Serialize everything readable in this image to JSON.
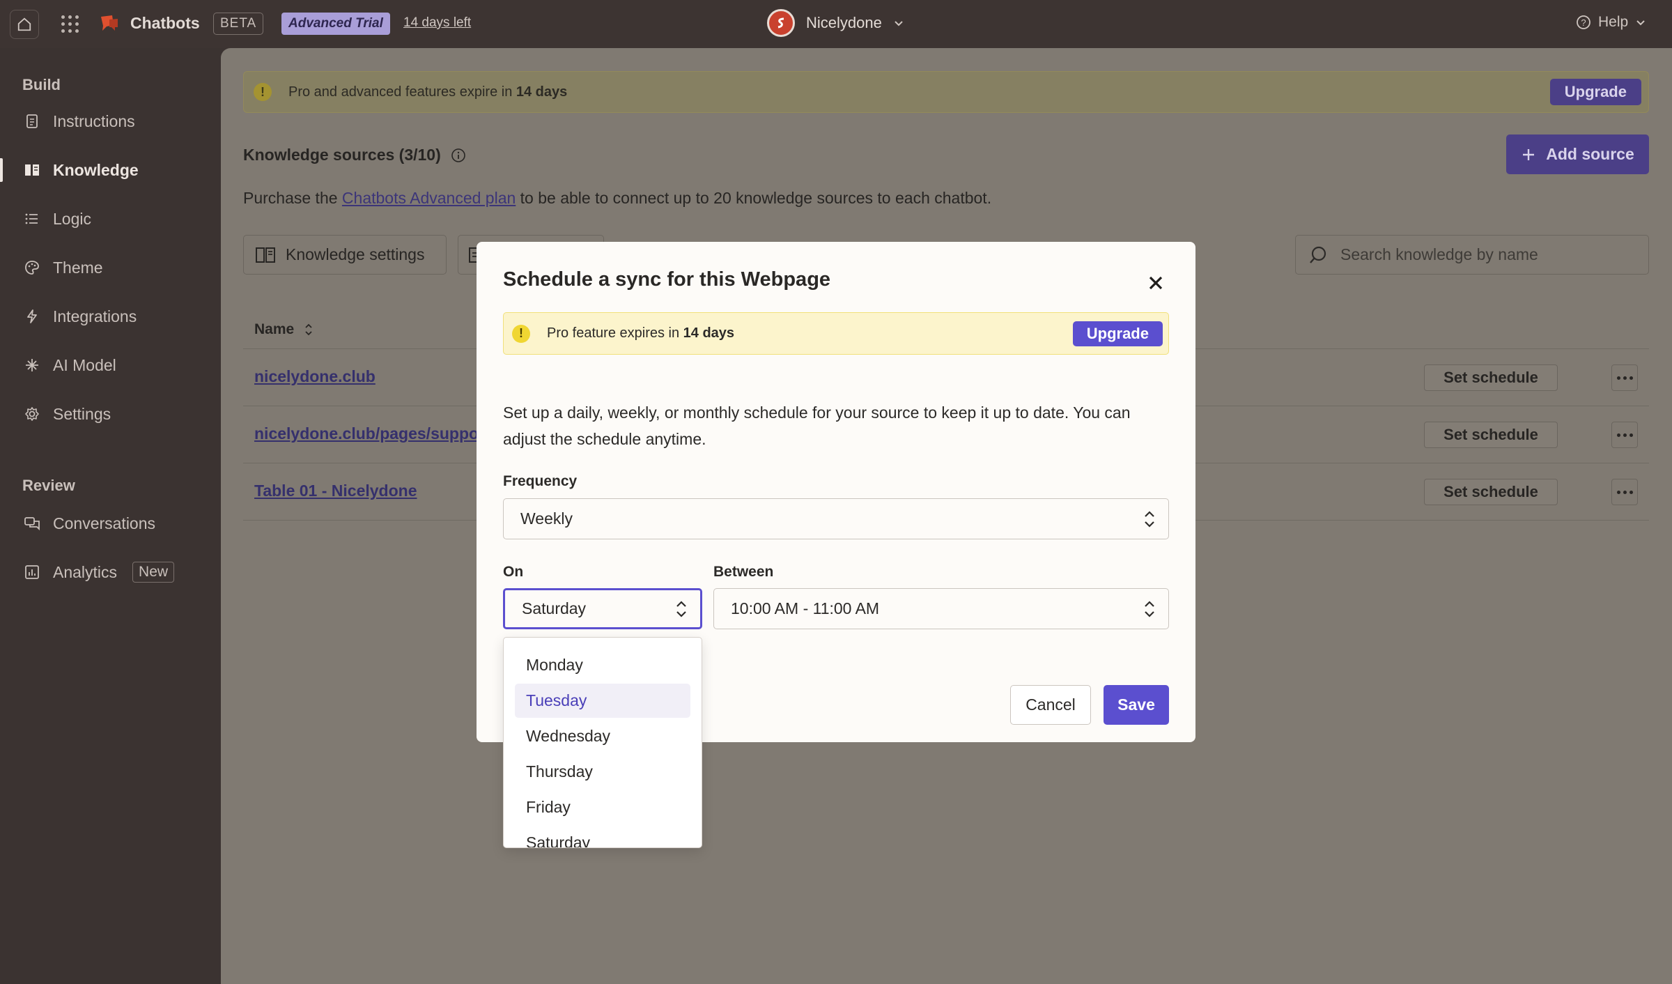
{
  "topbar": {
    "app_name": "Chatbots",
    "beta_label": "BETA",
    "trial_label": "Advanced Trial",
    "days_left": "14 days left",
    "workspace_name": "Nicelydone",
    "help_label": "Help"
  },
  "sidebar": {
    "build_heading": "Build",
    "review_heading": "Review",
    "items": [
      {
        "label": "Instructions",
        "icon": "document-icon"
      },
      {
        "label": "Knowledge",
        "icon": "book-icon",
        "active": true
      },
      {
        "label": "Logic",
        "icon": "list-icon"
      },
      {
        "label": "Theme",
        "icon": "palette-icon"
      },
      {
        "label": "Integrations",
        "icon": "bolt-icon"
      },
      {
        "label": "AI Model",
        "icon": "sparkle-icon"
      },
      {
        "label": "Settings",
        "icon": "gear-icon"
      }
    ],
    "review_items": [
      {
        "label": "Conversations",
        "icon": "chat-icon"
      },
      {
        "label": "Analytics",
        "icon": "chart-icon",
        "badge": "New"
      }
    ]
  },
  "main": {
    "banner_prefix": "Pro and advanced features expire in ",
    "banner_bold": "14 days",
    "upgrade_label": "Upgrade",
    "ks_title": "Knowledge sources (3/10)",
    "add_source_label": "Add source",
    "purchase_prefix": "Purchase the ",
    "purchase_link": "Chatbots Advanced plan",
    "purchase_suffix": " to be able to connect up to 20 knowledge sources to each chatbot.",
    "ks_settings_label": "Knowledge settings",
    "search_placeholder": "Search knowledge by name",
    "table": {
      "header_name": "Name",
      "rows": [
        {
          "name": "nicelydone.club",
          "action": "Set schedule"
        },
        {
          "name": "nicelydone.club/pages/suppo",
          "action": "Set schedule"
        },
        {
          "name": "Table 01 - Nicelydone",
          "action": "Set schedule"
        }
      ]
    }
  },
  "modal": {
    "title": "Schedule a sync for this Webpage",
    "banner_prefix": "Pro feature expires in ",
    "banner_bold": "14 days",
    "upgrade_label": "Upgrade",
    "description": "Set up a daily, weekly, or monthly schedule for your source to keep it up to date. You can adjust the schedule anytime.",
    "frequency_label": "Frequency",
    "frequency_value": "Weekly",
    "on_label": "On",
    "on_value": "Saturday",
    "between_label": "Between",
    "between_value": "10:00 AM - 11:00 AM",
    "cancel_label": "Cancel",
    "save_label": "Save",
    "day_options": [
      "Monday",
      "Tuesday",
      "Wednesday",
      "Thursday",
      "Friday",
      "Saturday"
    ],
    "highlighted_option": "Tuesday"
  },
  "colors": {
    "accent": "#5b4fcf",
    "sidebar_bg": "#3b3331",
    "overlay_main": "#807a72",
    "warning_bg": "#fcf4cc"
  }
}
